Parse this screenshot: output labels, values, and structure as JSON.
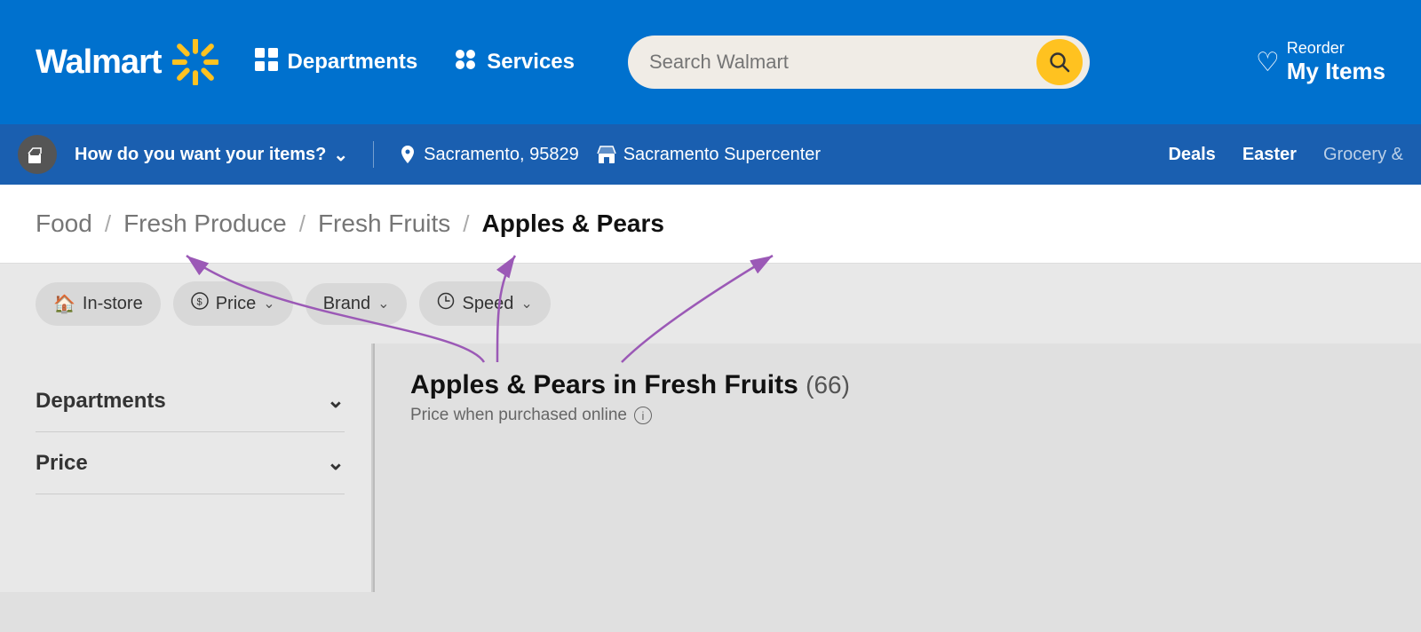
{
  "header": {
    "logo_text": "Walmart",
    "departments_label": "Departments",
    "services_label": "Services",
    "search_placeholder": "Search Walmart",
    "reorder_label": "Reorder",
    "my_items_label": "My Items"
  },
  "sub_nav": {
    "delivery_label": "How do you want your items?",
    "location": "Sacramento, 95829",
    "store": "Sacramento Supercenter",
    "links": [
      {
        "label": "Deals",
        "muted": false
      },
      {
        "label": "Easter",
        "muted": false
      },
      {
        "label": "Grocery &",
        "muted": true
      }
    ]
  },
  "breadcrumb": {
    "items": [
      {
        "label": "Food",
        "current": false
      },
      {
        "label": "Fresh Produce",
        "current": false
      },
      {
        "label": "Fresh Fruits",
        "current": false
      },
      {
        "label": "Apples & Pears",
        "current": true
      }
    ]
  },
  "filters": [
    {
      "icon": "🏠",
      "label": "In-store",
      "has_chevron": false
    },
    {
      "icon": "💲",
      "label": "Price",
      "has_chevron": true
    },
    {
      "icon": "",
      "label": "Brand",
      "has_chevron": true
    },
    {
      "icon": "🕐",
      "label": "Speed",
      "has_chevron": true
    }
  ],
  "sidebar": {
    "departments_label": "Departments",
    "price_label": "Price"
  },
  "products": {
    "heading": "Apples & Pears in Fresh Fruits",
    "count": "(66)",
    "price_note": "Price when purchased online"
  }
}
